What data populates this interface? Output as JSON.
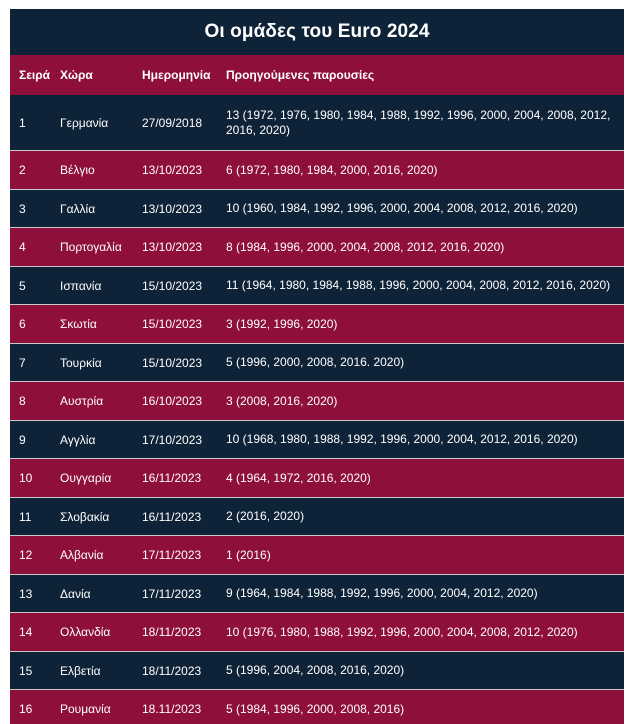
{
  "title": "Οι ομάδες του Euro 2024",
  "headers": {
    "rank": "Σειρά",
    "country": "Χώρα",
    "date": "Ημερομηνία",
    "previous": "Προηγούμενες παρουσίες"
  },
  "rows": [
    {
      "rank": "1",
      "country": "Γερμανία",
      "date": "27/09/2018",
      "previous": "13 (1972, 1976, 1980, 1984, 1988, 1992, 1996, 2000, 2004, 2008, 2012, 2016, 2020)"
    },
    {
      "rank": "2",
      "country": "Βέλγιο",
      "date": "13/10/2023",
      "previous": "6 (1972, 1980, 1984, 2000, 2016, 2020)"
    },
    {
      "rank": "3",
      "country": "Γαλλία",
      "date": "13/10/2023",
      "previous": "10 (1960, 1984, 1992, 1996, 2000, 2004, 2008, 2012, 2016, 2020)"
    },
    {
      "rank": "4",
      "country": "Πορτογαλία",
      "date": "13/10/2023",
      "previous": "8 (1984, 1996, 2000, 2004, 2008, 2012, 2016, 2020)"
    },
    {
      "rank": "5",
      "country": "Ισπανία",
      "date": "15/10/2023",
      "previous": "11 (1964, 1980, 1984, 1988, 1996, 2000, 2004, 2008, 2012, 2016, 2020)"
    },
    {
      "rank": "6",
      "country": "Σκωτία",
      "date": "15/10/2023",
      "previous": "3 (1992, 1996, 2020)"
    },
    {
      "rank": "7",
      "country": "Τουρκία",
      "date": "15/10/2023",
      "previous": "5 (1996, 2000, 2008, 2016. 2020)"
    },
    {
      "rank": "8",
      "country": "Αυστρία",
      "date": "16/10/2023",
      "previous": "3 (2008, 2016, 2020)"
    },
    {
      "rank": "9",
      "country": "Αγγλία",
      "date": "17/10/2023",
      "previous": "10 (1968, 1980, 1988, 1992, 1996, 2000, 2004, 2012, 2016, 2020)"
    },
    {
      "rank": "10",
      "country": "Ουγγαρία",
      "date": "16/11/2023",
      "previous": "4 (1964, 1972, 2016, 2020)"
    },
    {
      "rank": "11",
      "country": "Σλοβακία",
      "date": "16/11/2023",
      "previous": "2 (2016, 2020)"
    },
    {
      "rank": "12",
      "country": "Αλβανία",
      "date": "17/11/2023",
      "previous": "1 (2016)"
    },
    {
      "rank": "13",
      "country": "Δανία",
      "date": "17/11/2023",
      "previous": "9 (1964, 1984, 1988, 1992, 1996, 2000, 2004, 2012, 2020)"
    },
    {
      "rank": "14",
      "country": "Ολλανδία",
      "date": "18/11/2023",
      "previous": "10 (1976, 1980, 1988, 1992, 1996, 2000, 2004, 2008, 2012, 2020)"
    },
    {
      "rank": "15",
      "country": "Ελβετία",
      "date": "18/11/2023",
      "previous": "5 (1996, 2004, 2008, 2016, 2020)"
    },
    {
      "rank": "16",
      "country": "Ρουμανία",
      "date": "18.11/2023",
      "previous": "5 (1984, 1996, 2000, 2008, 2016)"
    }
  ]
}
